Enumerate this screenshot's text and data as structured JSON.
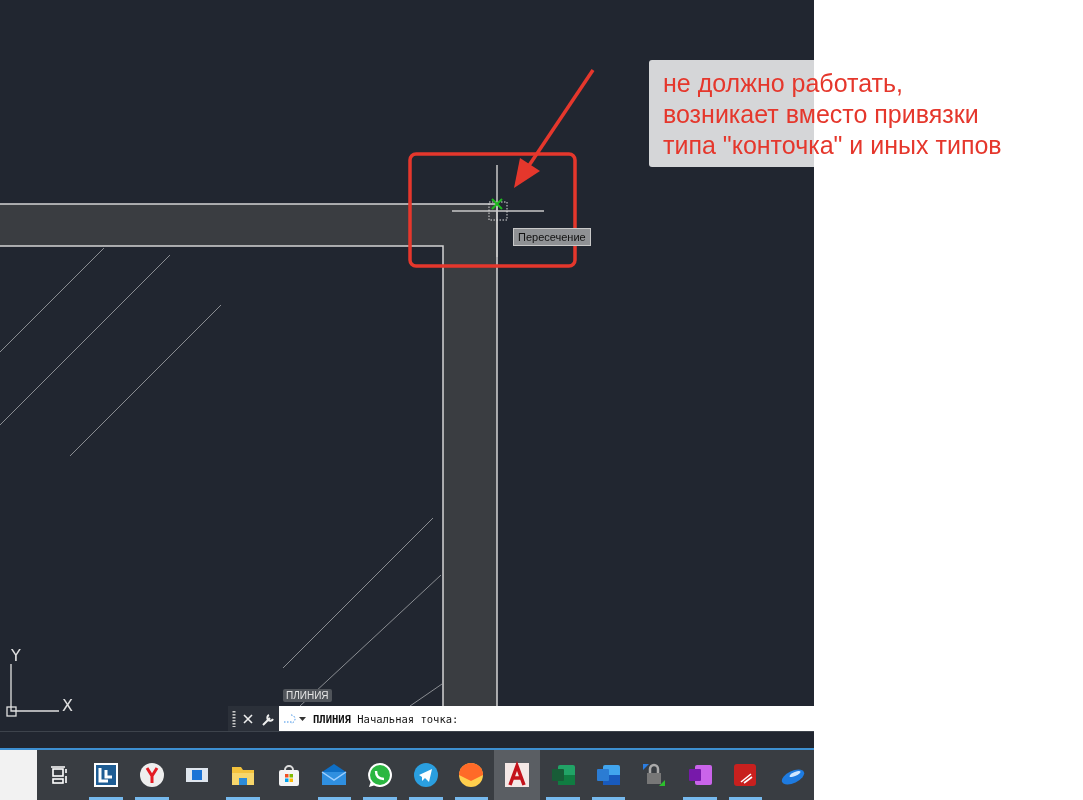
{
  "annotation": {
    "lines": [
      "не должно работать,",
      "возникает вместо привязки",
      "типа \"конточка\" и иных типов"
    ]
  },
  "snap_tooltip": "Пересечение",
  "ucs": {
    "y_label": "Y",
    "x_label": "X"
  },
  "command_line": {
    "tag": "ПЛИНИЯ",
    "prompt": "**ПЛИНИЯ** Начальная точка:"
  },
  "taskbar": {
    "items": [
      {
        "kind": "task-view",
        "running": false,
        "selected": false
      },
      {
        "kind": "l-logo",
        "running": true,
        "selected": false
      },
      {
        "kind": "browser-y",
        "running": true,
        "selected": false
      },
      {
        "kind": "window",
        "running": false,
        "selected": false
      },
      {
        "kind": "folder",
        "running": true,
        "selected": false
      },
      {
        "kind": "store",
        "running": false,
        "selected": false
      },
      {
        "kind": "mail",
        "running": true,
        "selected": false
      },
      {
        "kind": "chat",
        "running": true,
        "selected": false
      },
      {
        "kind": "paper-plane",
        "running": true,
        "selected": false
      },
      {
        "kind": "orange-mail",
        "running": true,
        "selected": false
      },
      {
        "kind": "cad",
        "running": false,
        "selected": true
      },
      {
        "kind": "spreadsheet",
        "running": true,
        "selected": false
      },
      {
        "kind": "document",
        "running": true,
        "selected": false
      },
      {
        "kind": "lock",
        "running": false,
        "selected": false
      },
      {
        "kind": "notebook",
        "running": true,
        "selected": false
      },
      {
        "kind": "pdf",
        "running": true,
        "selected": false
      },
      {
        "kind": "disc",
        "running": false,
        "selected": false
      }
    ]
  }
}
